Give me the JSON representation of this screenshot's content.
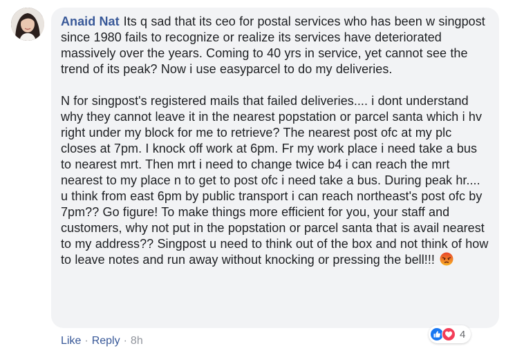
{
  "comment": {
    "author": "Anaid Nat",
    "paragraph1": "Its q sad that its ceo for postal services who has been w singpost since 1980 fails to recognize or realize its services have deteriorated massively over the years. Coming to 40 yrs in service, yet cannot see the trend of its peak? Now i use easyparcel to do my deliveries.",
    "paragraph2": "N for singpost's registered mails that failed deliveries.... i dont understand why they cannot leave it in the nearest popstation or parcel santa which i hv right under my block for me to retrieve? The nearest post ofc at my plc closes at 7pm. I knock off work at 6pm. Fr my work place i need take a bus to nearest mrt. Then mrt i need to change twice b4 i can reach the mrt nearest to my place n to get to post ofc i need take a bus. During peak hr.... u think from east 6pm by public transport i can reach northeast's post ofc by 7pm?? Go figure! To make things more efficient for you, your staff and customers, why not put in the popstation or parcel santa that is avail nearest to my address?? Singpost u need to think out of the box and not think of how to leave notes and run away without knocking or pressing the bell!!!",
    "trailing_emoji": "angry-face"
  },
  "reactions": {
    "icons": [
      "like",
      "love"
    ],
    "count": "4",
    "like_color": "#1877f2",
    "love_color": "#f33e58"
  },
  "actions": {
    "like_label": "Like",
    "reply_label": "Reply",
    "separator": "·",
    "timestamp": "8h"
  },
  "colors": {
    "author": "#385898",
    "bubble_bg": "#f2f3f5",
    "meta": "#90949c"
  }
}
